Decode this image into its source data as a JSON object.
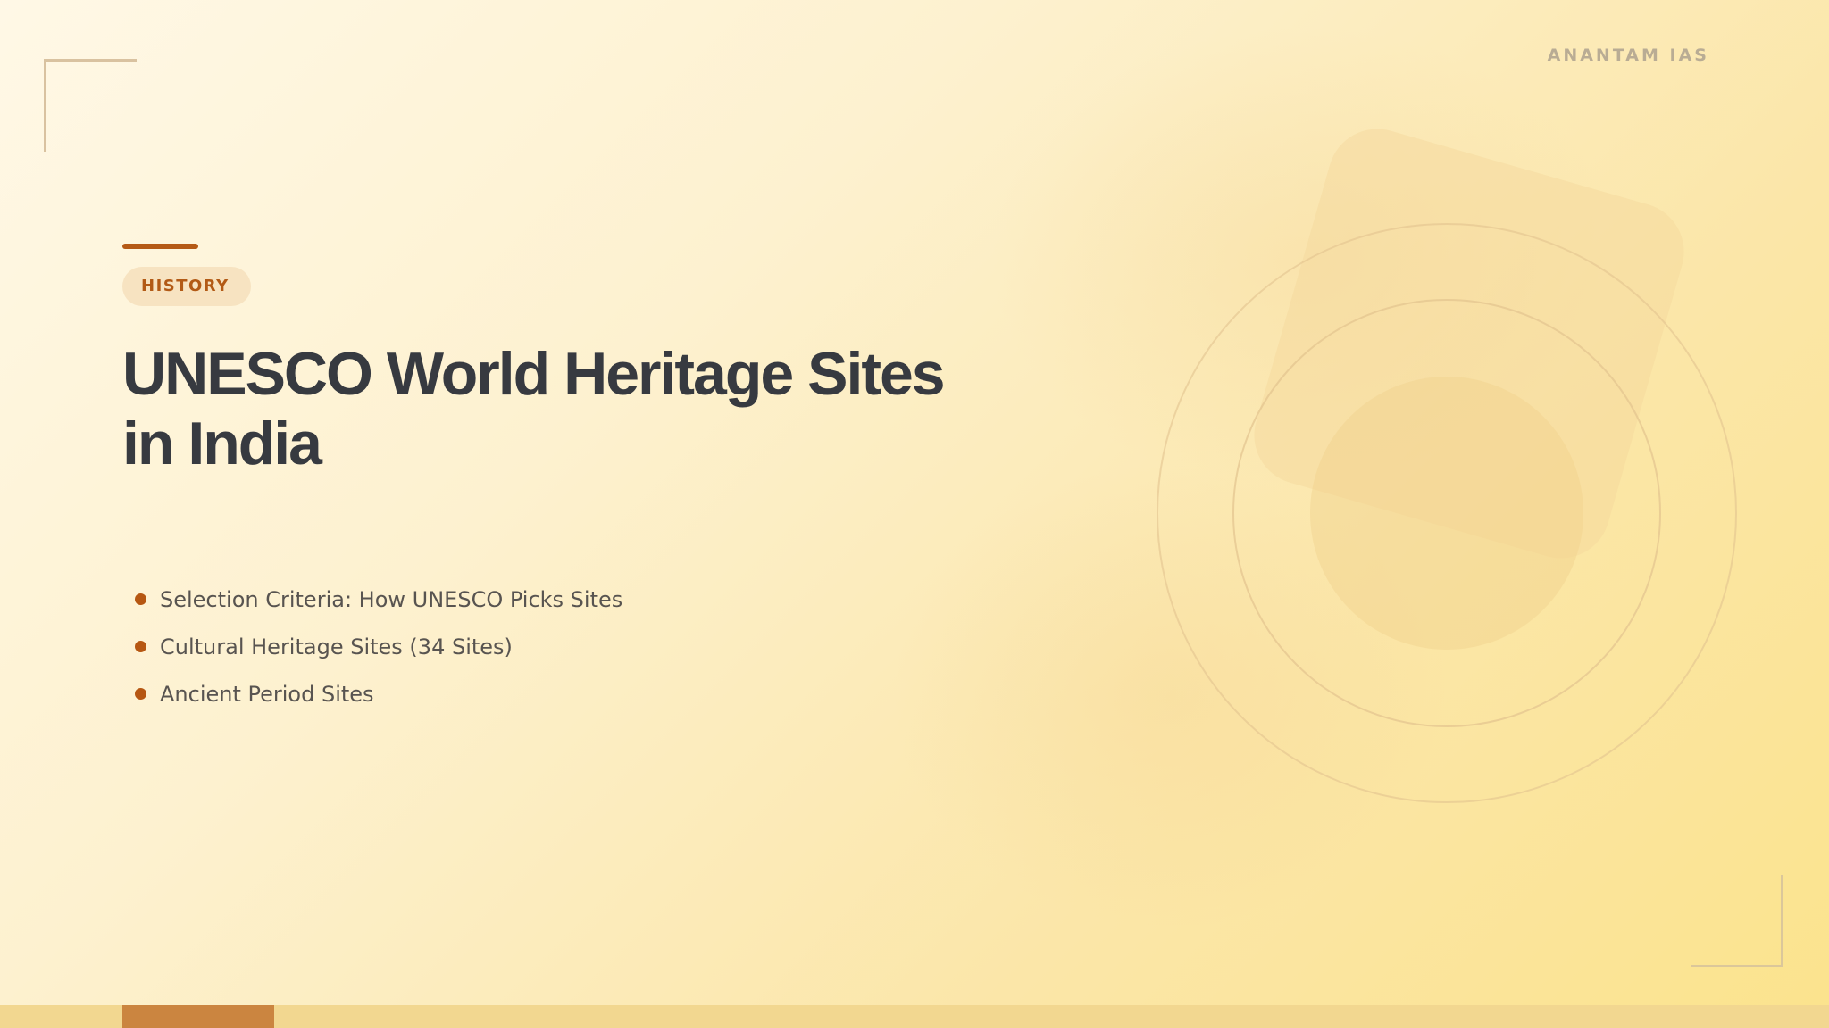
{
  "brand": {
    "name": "ANANTAM IAS"
  },
  "slide": {
    "category": "HISTORY",
    "title_line_1": "UNESCO World Heritage Sites",
    "title_line_2": "in India",
    "bullets": [
      "Selection Criteria: How UNESCO Picks Sites",
      "Cultural Heritage Sites (34 Sites)",
      "Ancient Period Sites"
    ]
  },
  "colors": {
    "accent": "#b55a16",
    "title": "#373a40",
    "body_text": "#585450",
    "badge_background": "#f7e3c1",
    "background_light": "#fff8e6",
    "background_warm": "#fbe38d"
  }
}
